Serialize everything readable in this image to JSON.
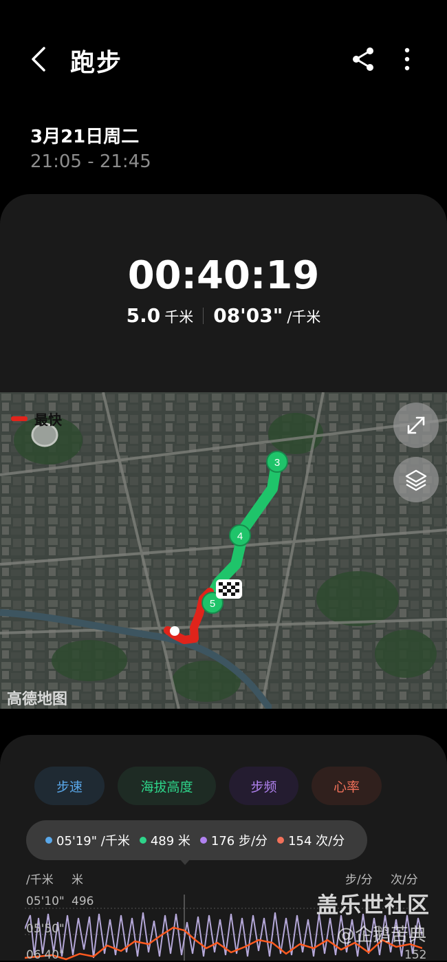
{
  "header": {
    "title": "跑步",
    "back_icon": "chevron-left-icon",
    "share_icon": "share-icon",
    "more_icon": "more-vertical-icon"
  },
  "session": {
    "date": "3月21日周二",
    "time_range": "21:05 - 21:45"
  },
  "summary": {
    "duration": "00:40:19",
    "distance_value": "5.0",
    "distance_unit": "千米",
    "pace_value": "08'03\"",
    "pace_unit": "/千米"
  },
  "map": {
    "legend_label": "最快",
    "legend_color": "#e0241b",
    "route_color_normal": "#1fc46a",
    "markers": [
      "3",
      "4",
      "5"
    ],
    "credit": "高德地图",
    "expand_icon": "expand-icon",
    "layers_icon": "layers-icon",
    "finish_icon": "checkered-flag-icon"
  },
  "chart": {
    "chips": [
      {
        "label": "步速",
        "color": "#5aa8ea"
      },
      {
        "label": "海拔高度",
        "color": "#2ed48a"
      },
      {
        "label": "步频",
        "color": "#b182f0"
      },
      {
        "label": "心率",
        "color": "#f2715a"
      }
    ],
    "tooltip": {
      "pace": "05'19\" /千米",
      "altitude": "489 米",
      "cadence": "176 步/分",
      "heart_rate": "154 次/分"
    },
    "axes": {
      "pace_unit": "/千米",
      "altitude_unit": "米",
      "cadence_unit": "步/分",
      "hr_unit": "次/分",
      "pace_ticks": [
        "05'10\"",
        "05'50\"",
        "06'40\""
      ],
      "altitude_top": "496",
      "hr_bottom": "152"
    }
  },
  "watermark": {
    "line1": "盖乐世社区",
    "line2": "@企鹅苦典"
  }
}
